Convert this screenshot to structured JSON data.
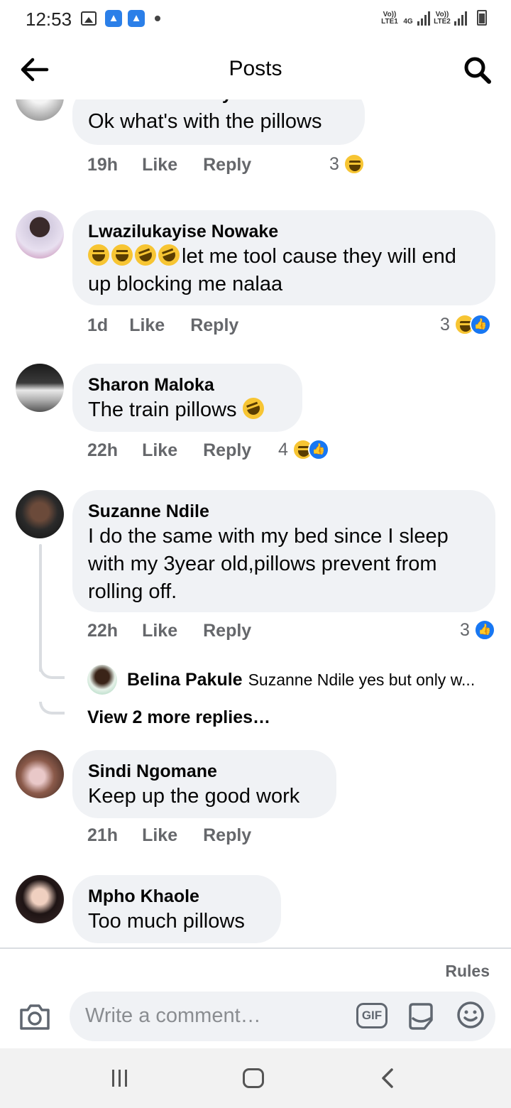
{
  "status_bar": {
    "time": "12:53",
    "network_left": "Vo)) LTE1",
    "network_4g": "4G",
    "network_right": "Vo)) LTE2"
  },
  "header": {
    "title": "Posts",
    "back_icon": "arrow-left-icon",
    "search_icon": "search-icon"
  },
  "comments": [
    {
      "name": "Nondumiso Folly Khela",
      "text": "Ok what's with the pillows",
      "time": "19h",
      "like_label": "Like",
      "reply_label": "Reply",
      "reaction_count": "3",
      "reactions": [
        "haha"
      ]
    },
    {
      "name": "Lwazilukayise Nowake",
      "text": "let me tool cause they will end up blocking me nalaa",
      "emoji_prefix": [
        "laughing",
        "laughing",
        "rofl",
        "rofl"
      ],
      "time": "1d",
      "like_label": "Like",
      "reply_label": "Reply",
      "reaction_count": "3",
      "reactions": [
        "haha",
        "like"
      ]
    },
    {
      "name": "Sharon Maloka",
      "text": "The train pillows",
      "emoji_suffix": [
        "rofl"
      ],
      "time": "22h",
      "like_label": "Like",
      "reply_label": "Reply",
      "reaction_count": "4",
      "reactions": [
        "haha",
        "like"
      ]
    },
    {
      "name": "Suzanne Ndile",
      "text": "I do the same with my bed since I sleep with my 3year old,pillows prevent from rolling off.",
      "time": "22h",
      "like_label": "Like",
      "reply_label": "Reply",
      "reaction_count": "3",
      "reactions": [
        "like"
      ],
      "reply_preview": {
        "name": "Belina Pakule",
        "text": "Suzanne Ndile yes but only w..."
      },
      "view_more": "View 2 more replies…"
    },
    {
      "name": "Sindi Ngomane",
      "text": "Keep up the good work",
      "time": "21h",
      "like_label": "Like",
      "reply_label": "Reply"
    },
    {
      "name": "Mpho Khaole",
      "text": "Too much pillows"
    }
  ],
  "composer": {
    "rules_label": "Rules",
    "placeholder": "Write a comment…",
    "gif_label": "GIF",
    "camera_icon": "camera-icon",
    "sticker_icon": "sticker-icon",
    "emoji_icon": "smiley-icon"
  },
  "nav": {
    "recent_icon": "recent-apps-icon",
    "home_icon": "home-icon",
    "back_icon": "chevron-left-icon"
  },
  "colors": {
    "bubble": "#f0f2f5",
    "secondary_text": "#65676b",
    "like_blue": "#1877f2",
    "haha_yellow": "#f7c533"
  }
}
